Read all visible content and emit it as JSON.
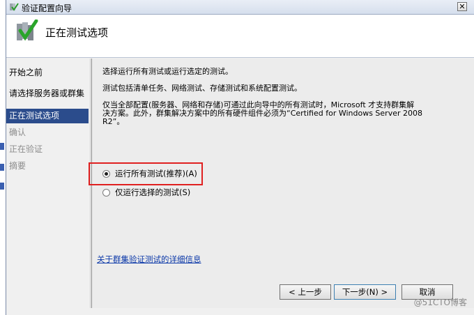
{
  "window": {
    "title": "验证配置向导",
    "close_label": "✕"
  },
  "header": {
    "page_title": "正在测试选项"
  },
  "nav": {
    "items": [
      {
        "label": "开始之前",
        "state": "normal"
      },
      {
        "label": "请选择服务器或群集",
        "state": "normal"
      },
      {
        "label": "正在测试选项",
        "state": "active"
      },
      {
        "label": "确认",
        "state": "disabled"
      },
      {
        "label": "正在验证",
        "state": "disabled"
      },
      {
        "label": "摘要",
        "state": "disabled"
      }
    ]
  },
  "content": {
    "line1": "选择运行所有测试或运行选定的测试。",
    "line2": "测试包括清单任务、网络测试、存储测试和系统配置测试。",
    "line3a": "仅当全部配置(服务器、网络和存储)可通过此向导中的所有测试时，Microsoft 才支持群集解",
    "line3b": "决方案。此外，群集解决方案中的所有硬件组件必须为“Certified for Windows Server 2008",
    "line3c": "R2”。",
    "radio_all": "运行所有测试(推荐)(A)",
    "radio_selected": "仅运行选择的测试(S)",
    "link": "关于群集验证测试的详细信息"
  },
  "buttons": {
    "back": "< 上一步",
    "next": "下一步(N) >",
    "cancel": "取消"
  },
  "watermark": "@51CTO博客",
  "colors": {
    "nav_active": "#2b4c8c",
    "highlight_border": "#e02020",
    "link": "#0b38a8"
  }
}
